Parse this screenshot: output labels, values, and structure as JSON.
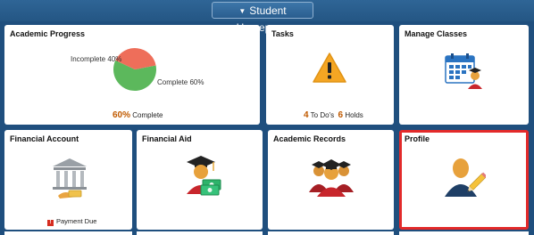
{
  "header": {
    "title": "Student Homepage"
  },
  "tiles": {
    "academic_progress": {
      "title": "Academic Progress",
      "label_incomplete": "Incomplete 40%",
      "label_complete": "Complete 60%",
      "progress_value": "60%",
      "progress_text": "Complete",
      "complete_fraction": 0.6,
      "colors": {
        "complete": "#5cb85c",
        "incomplete": "#ee6e5a"
      }
    },
    "tasks": {
      "title": "Tasks",
      "todos_count": "4",
      "todos_label": "To Do's",
      "holds_count": "6",
      "holds_label": "Holds"
    },
    "manage_classes": {
      "title": "Manage Classes"
    },
    "financial_account": {
      "title": "Financial Account",
      "status_text": "Payment Due",
      "badge": "!"
    },
    "financial_aid": {
      "title": "Financial Aid"
    },
    "academic_records": {
      "title": "Academic Records"
    },
    "profile": {
      "title": "Profile"
    }
  },
  "icons": [
    "chevron-down-icon",
    "warning-icon",
    "calendar-icon",
    "bank-icon",
    "graduate-money-icon",
    "graduates-icon",
    "user-edit-icon"
  ],
  "colors": {
    "background": "#1f4f7e",
    "selected_border": "#e32a2a",
    "accent_number": "#c05a00"
  }
}
